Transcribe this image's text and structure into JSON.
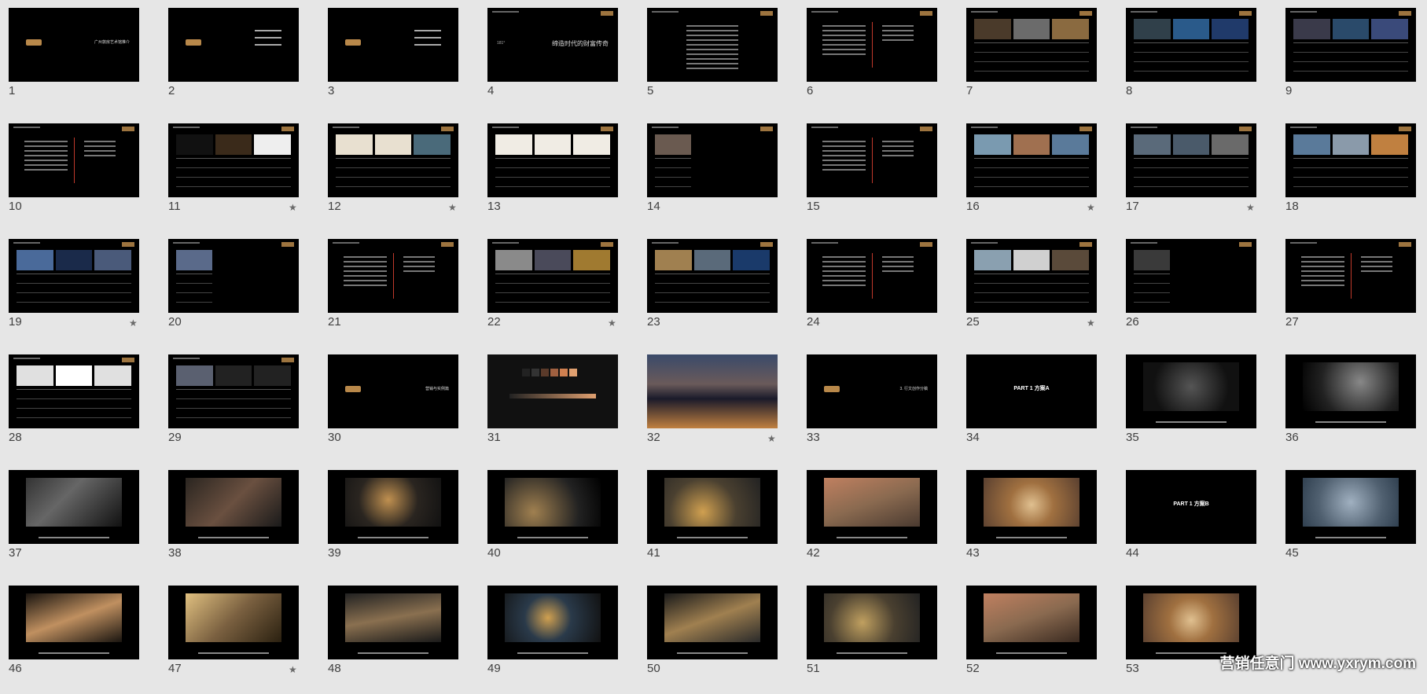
{
  "watermark": "营销任意门  www.yxrym.com",
  "slides": [
    {
      "n": "1",
      "kind": "logo-title",
      "text": "广州敦房艺术馆推介"
    },
    {
      "n": "2",
      "kind": "menu"
    },
    {
      "n": "3",
      "kind": "menu"
    },
    {
      "n": "4",
      "kind": "title",
      "text": "缔造时代的财富传奇",
      "sub": "181°"
    },
    {
      "n": "5",
      "kind": "text-center"
    },
    {
      "n": "6",
      "kind": "split"
    },
    {
      "n": "7",
      "kind": "table",
      "photos": [
        "#4a3a2a",
        "#6b6b6b",
        "#8a6a40"
      ]
    },
    {
      "n": "8",
      "kind": "table",
      "photos": [
        "#30404a",
        "#2a5a8a",
        "#203a6a"
      ]
    },
    {
      "n": "9",
      "kind": "table",
      "photos": [
        "#3a3a4a",
        "#2a4a6a",
        "#3a4a7a"
      ]
    },
    {
      "n": "10",
      "kind": "split"
    },
    {
      "n": "11",
      "kind": "table",
      "star": true,
      "photos": [
        "#111",
        "#3a2a1a",
        "#eee"
      ]
    },
    {
      "n": "12",
      "kind": "table",
      "star": true,
      "photos": [
        "#e8e0d0",
        "#e8e0d0",
        "#4a6a7a"
      ]
    },
    {
      "n": "13",
      "kind": "table",
      "photos": [
        "#f0ece4",
        "#f0ece4",
        "#f0ece4"
      ]
    },
    {
      "n": "14",
      "kind": "single-photo",
      "photo": "#6a5a50"
    },
    {
      "n": "15",
      "kind": "split"
    },
    {
      "n": "16",
      "kind": "table",
      "star": true,
      "photos": [
        "#7a9ab0",
        "#a07050",
        "#5a7a9a"
      ]
    },
    {
      "n": "17",
      "kind": "table",
      "star": true,
      "photos": [
        "#5a6a7a",
        "#4a5a6a",
        "#6a6a6a"
      ]
    },
    {
      "n": "18",
      "kind": "table",
      "photos": [
        "#5a7a9a",
        "#8a9aaa",
        "#c08040"
      ]
    },
    {
      "n": "19",
      "kind": "table",
      "star": true,
      "photos": [
        "#4a6a9a",
        "#1a2a4a",
        "#4a5a7a"
      ]
    },
    {
      "n": "20",
      "kind": "single-photo",
      "photo": "#5a6a8a"
    },
    {
      "n": "21",
      "kind": "split"
    },
    {
      "n": "22",
      "kind": "table",
      "star": true,
      "photos": [
        "#8a8a8a",
        "#4a4a5a",
        "#a07a30"
      ]
    },
    {
      "n": "23",
      "kind": "table",
      "photos": [
        "#a08050",
        "#5a6a7a",
        "#1a3a6a"
      ]
    },
    {
      "n": "24",
      "kind": "split"
    },
    {
      "n": "25",
      "kind": "table",
      "star": true,
      "photos": [
        "#8aa0b0",
        "#d0d0d0",
        "#5a4a3a"
      ]
    },
    {
      "n": "26",
      "kind": "single-photo",
      "photo": "#3a3a3a"
    },
    {
      "n": "27",
      "kind": "split"
    },
    {
      "n": "28",
      "kind": "table",
      "photos": [
        "#e0e0e0",
        "#ffffff",
        "#e0e0e0"
      ]
    },
    {
      "n": "29",
      "kind": "table",
      "photos": [
        "#5a6070",
        "#222",
        "#222"
      ]
    },
    {
      "n": "30",
      "kind": "logo-title",
      "text": "营销与实例篇"
    },
    {
      "n": "31",
      "kind": "swatch"
    },
    {
      "n": "32",
      "kind": "full-photo",
      "star": true,
      "photo": "linear-gradient(#3a4a6a,#6a5a5a 40%,#1a1a2a 60%,#c08040 100%)"
    },
    {
      "n": "33",
      "kind": "logo-title",
      "text": "3. 行文创作分稿"
    },
    {
      "n": "34",
      "kind": "center",
      "text": "PART 1  方案A"
    },
    {
      "n": "35",
      "kind": "photo-cap",
      "photo": "radial-gradient(circle at 50% 50%,#555,#111 70%)"
    },
    {
      "n": "36",
      "kind": "photo-cap",
      "photo": "radial-gradient(circle at 60% 40%,#888,#222 60%,#000)"
    },
    {
      "n": "37",
      "kind": "photo-cap",
      "photo": "linear-gradient(135deg,#333,#666 40%,#111)"
    },
    {
      "n": "38",
      "kind": "photo-cap",
      "photo": "linear-gradient(135deg,#2a2520,#6a5040,#1a1a1a)"
    },
    {
      "n": "39",
      "kind": "photo-cap",
      "photo": "radial-gradient(circle at 45% 45%,#c09050,#2a2520 50%,#111)"
    },
    {
      "n": "40",
      "kind": "photo-cap",
      "photo": "radial-gradient(circle at 30% 70%,#a08050,#222 60%,#000)"
    },
    {
      "n": "41",
      "kind": "photo-cap",
      "photo": "radial-gradient(circle at 40% 70%,#d0a050,#4a4030 50%,#222)"
    },
    {
      "n": "42",
      "kind": "photo-cap",
      "photo": "linear-gradient(160deg,#c08060,#8a6a50,#4a3a30)"
    },
    {
      "n": "43",
      "kind": "photo-cap",
      "photo": "radial-gradient(circle at 50% 55%,#e0c090,#a07040 40%,#5a4030)"
    },
    {
      "n": "44",
      "kind": "center",
      "text": "PART 1   方案B"
    },
    {
      "n": "45",
      "kind": "photo-cap",
      "photo": "radial-gradient(circle,#a0b0c0,#506070 60%,#304050)"
    },
    {
      "n": "46",
      "kind": "photo-cap",
      "photo": "linear-gradient(160deg,#1a1510,#c09060 50%,#1a1510)"
    },
    {
      "n": "47",
      "kind": "photo-cap",
      "star": true,
      "photo": "linear-gradient(135deg,#e0c080,#7a6040,#2a2010)"
    },
    {
      "n": "48",
      "kind": "photo-cap",
      "photo": "linear-gradient(170deg,#222,#8a7050,#1a1a1a)"
    },
    {
      "n": "49",
      "kind": "photo-cap",
      "photo": "radial-gradient(circle at 45% 50%,#d0a050,#2a3a4a 40%,#111)"
    },
    {
      "n": "50",
      "kind": "photo-cap",
      "photo": "linear-gradient(160deg,#1a1a1a,#a08050,#2a2a2a)"
    },
    {
      "n": "51",
      "kind": "photo-cap",
      "photo": "radial-gradient(circle at 40% 60%,#c0a060,#4a4030 50%,#222)"
    },
    {
      "n": "52",
      "kind": "photo-cap",
      "photo": "linear-gradient(160deg,#c08060,#8a6a50,#3a2a20)"
    },
    {
      "n": "53",
      "kind": "photo-cap",
      "photo": "radial-gradient(circle at 50% 55%,#e0c090,#a07040 40%,#5a4030)"
    }
  ]
}
